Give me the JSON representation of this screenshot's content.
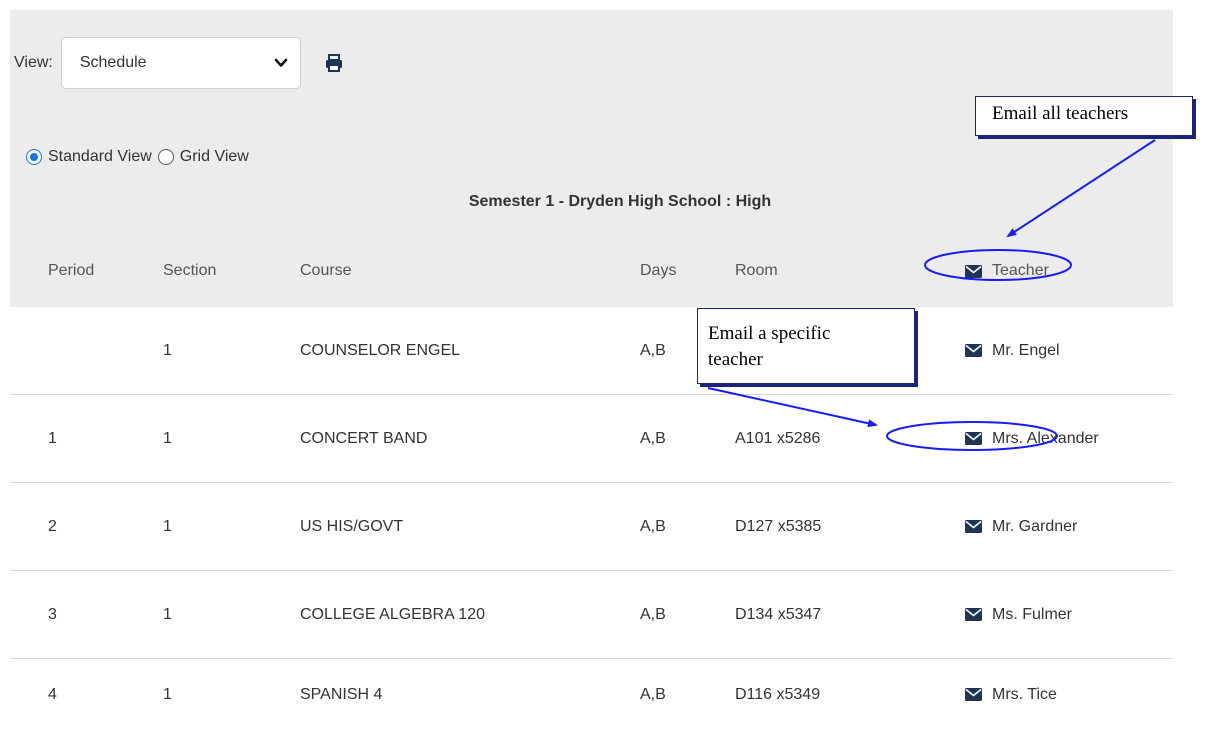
{
  "toolbar": {
    "view_label": "View:",
    "view_selected": "Schedule",
    "icons": {
      "dropdown": "chevron-down-icon",
      "print": "print-icon"
    }
  },
  "view_mode": {
    "options": [
      {
        "label": "Standard View",
        "checked": true
      },
      {
        "label": "Grid View",
        "checked": false
      }
    ]
  },
  "semester_title": "Semester 1 - Dryden High School : High",
  "table": {
    "headers": {
      "period": "Period",
      "section": "Section",
      "course": "Course",
      "days": "Days",
      "room": "Room",
      "teacher": "Teacher"
    },
    "rows": [
      {
        "period": "",
        "section": "1",
        "course": "COUNSELOR ENGEL",
        "days": "A,B",
        "room": "",
        "teacher": "Mr. Engel"
      },
      {
        "period": "1",
        "section": "1",
        "course": "CONCERT BAND",
        "days": "A,B",
        "room": "A101 x5286",
        "teacher": "Mrs. Alexander"
      },
      {
        "period": "2",
        "section": "1",
        "course": "US HIS/GOVT",
        "days": "A,B",
        "room": "D127 x5385",
        "teacher": "Mr. Gardner"
      },
      {
        "period": "3",
        "section": "1",
        "course": "COLLEGE ALGEBRA 120",
        "days": "A,B",
        "room": "D134 x5347",
        "teacher": "Ms. Fulmer"
      },
      {
        "period": "4",
        "section": "1",
        "course": "SPANISH 4",
        "days": "A,B",
        "room": "D116 x5349",
        "teacher": "Mrs. Tice"
      }
    ]
  },
  "annotations": {
    "email_all": "Email all teachers",
    "email_specific_line1": "Email a specific",
    "email_specific_line2": "teacher"
  },
  "colors": {
    "panel_bg": "#ececec",
    "radio_accent": "#1a73e8",
    "icon_navy": "#1f3556",
    "annotation_blue": "#1a1aff"
  }
}
